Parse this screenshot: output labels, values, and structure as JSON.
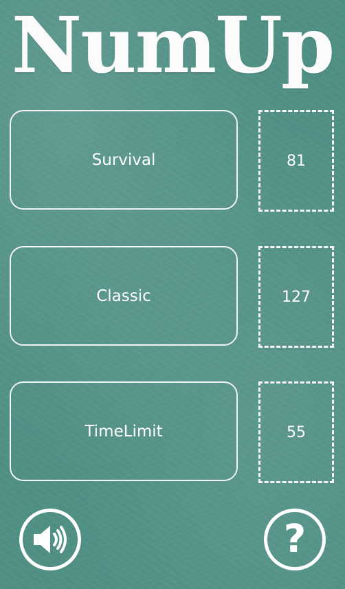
{
  "app": {
    "title": "NumUp"
  },
  "modes": [
    {
      "label": "Survival",
      "score": "81"
    },
    {
      "label": "Classic",
      "score": "127"
    },
    {
      "label": "TimeLimit",
      "score": "55"
    }
  ],
  "footer": {
    "sound_icon": "speaker-volume-icon",
    "help_icon": "question-mark-icon",
    "help_glyph": "?"
  },
  "colors": {
    "background": "#4f8f84",
    "foreground": "#ffffff"
  }
}
